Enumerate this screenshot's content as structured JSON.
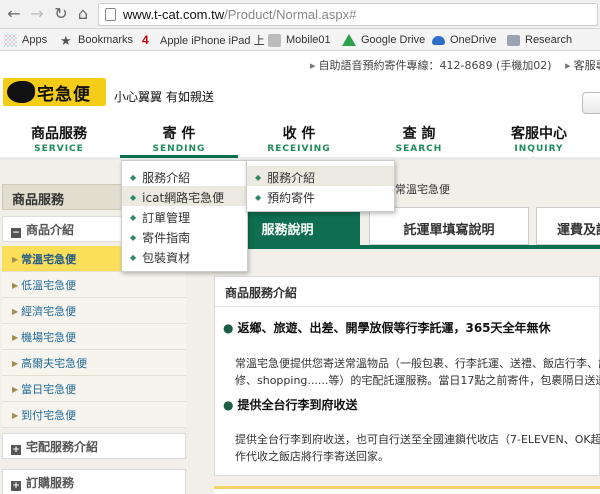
{
  "browser": {
    "url_host": "www.t-cat.com.tw",
    "url_path": "/Product/Normal.aspx#",
    "bookmarks": [
      "Apps",
      "Bookmarks",
      "Apple iPhone iPad 上",
      "Mobile01",
      "Google Drive",
      "OneDrive",
      "Research"
    ]
  },
  "header": {
    "topbar_text": "自助語音預約寄件專線：412-8689 (手機加02)",
    "topbar_right": "客服專",
    "logo_text": "宅急便",
    "slogan": "小心翼翼 有如親送"
  },
  "nav": [
    {
      "zh": "商品服務",
      "en": "SERVICE"
    },
    {
      "zh": "寄 件",
      "en": "SENDING"
    },
    {
      "zh": "收 件",
      "en": "RECEIVING"
    },
    {
      "zh": "查 詢",
      "en": "SEARCH"
    },
    {
      "zh": "客服中心",
      "en": "INQUIRY"
    }
  ],
  "dropdown_sending": [
    "服務介紹",
    "icat網路宅急便",
    "訂單管理",
    "寄件指南",
    "包裝資材"
  ],
  "dropdown_icat": [
    "服務介紹",
    "預約寄件"
  ],
  "breadcrumb": "常溫宅急便",
  "sidebar": {
    "title": "商品服務",
    "section_product": "商品介紹",
    "items": [
      "常溫宅急便",
      "低溫宅急便",
      "經濟宅急便",
      "機場宅急便",
      "高爾夫宅急便",
      "當日宅急便",
      "到付宅急便"
    ],
    "section_delivery": "宅配服務介紹",
    "section_order": "訂購服務"
  },
  "tabs": [
    "服務說明",
    "託運單填寫說明",
    "運費及託"
  ],
  "content": {
    "panel_title": "商品服務介紹",
    "h1": "返鄉、旅遊、出差、開學放假等行李託運，365天全年無休",
    "p1_line1": "常溫宅急便提供您寄送常溫物品（一般包裹、行李託運、送禮、飯店行李、訂",
    "p1_line2": "修、shopping......等）的宅配託運服務。當日17點之前寄件，包裹隔日送達",
    "h2": "提供全台行李到府收送",
    "p2_line1": "提供全台行李到府收送，也可自行送至全國連鎖代收店（7-ELEVEN、OK超商",
    "p2_line2": "作代收之飯店將行李寄送回家。"
  },
  "colors": {
    "brand_yellow": "#f5cc17",
    "brand_green": "#0e6e4f",
    "active_sidebar": "#fbdf5a"
  }
}
